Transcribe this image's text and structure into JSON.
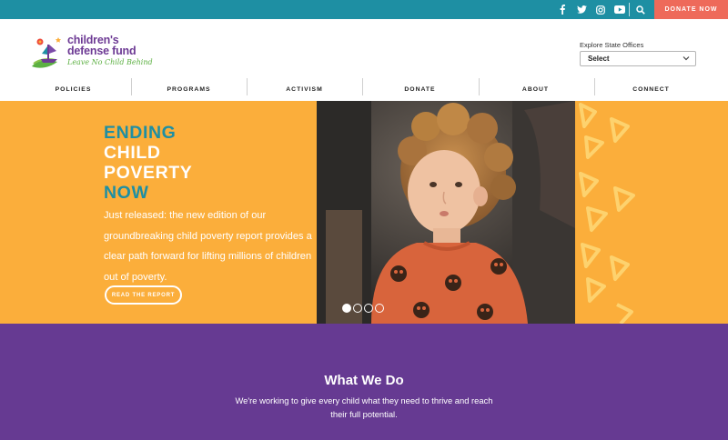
{
  "topbar": {
    "social_icons": [
      "facebook-icon",
      "twitter-icon",
      "instagram-icon",
      "youtube-icon",
      "search-icon"
    ],
    "donate_label": "DONATE NOW",
    "colors": {
      "bar": "#1e8fa3",
      "donate": "#ee6a5a"
    }
  },
  "header": {
    "logo": {
      "line1": "children's",
      "line2": "defense fund",
      "tagline": "Leave No Child Behind"
    },
    "explore_label": "Explore State Offices",
    "select_value": "Select"
  },
  "nav": {
    "items": [
      {
        "label": "POLICIES"
      },
      {
        "label": "PROGRAMS"
      },
      {
        "label": "ACTIVISM"
      },
      {
        "label": "DONATE"
      },
      {
        "label": "ABOUT"
      },
      {
        "label": "CONNECT"
      }
    ]
  },
  "hero": {
    "title_line1": "ENDING",
    "title_line2": "CHILD",
    "title_line3": "POVERTY",
    "title_line4": "NOW",
    "body": "Just released: the new edition of our groundbreaking child poverty report provides a clear path forward for lifting millions of children out of poverty.",
    "button_label": "READ THE REPORT",
    "slides": 4,
    "active_slide": 1,
    "colors": {
      "background": "#fbae3b",
      "accent": "#1e8fa3"
    }
  },
  "what_we_do": {
    "title": "What We Do",
    "text": "We're working to give every child what they need to thrive and reach their full potential.",
    "color": "#663a92"
  }
}
